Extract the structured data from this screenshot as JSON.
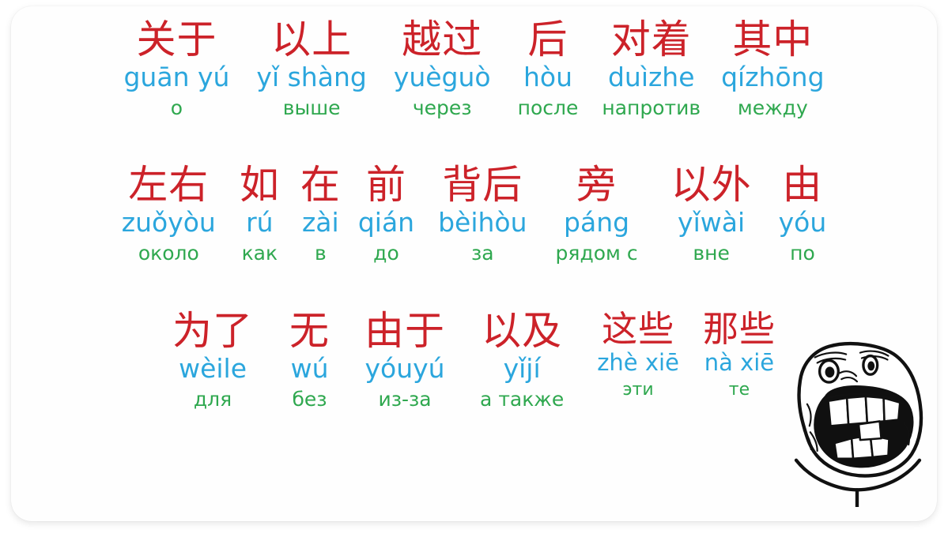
{
  "card": {
    "accent_red": "#cc2229",
    "accent_blue": "#2ba6dd",
    "accent_green": "#2fa84f",
    "background": "#fefefe"
  },
  "rows": [
    {
      "entries": [
        {
          "hanzi": "关于",
          "pinyin": "guān yú",
          "gloss": "о",
          "size": "",
          "gap": 0
        },
        {
          "hanzi": "以上",
          "pinyin": "yǐ shàng",
          "gloss": "выше",
          "size": "",
          "gap": 34
        },
        {
          "hanzi": "越过",
          "pinyin": "yuèguò",
          "gloss": "через",
          "size": "",
          "gap": 34
        },
        {
          "hanzi": "后",
          "pinyin": "hòu",
          "gloss": "после",
          "size": "",
          "gap": 34
        },
        {
          "hanzi": "对着",
          "pinyin": "duìzhe",
          "gloss": "напротив",
          "size": "",
          "gap": 30
        },
        {
          "hanzi": "其中",
          "pinyin": "qízhōng",
          "gloss": "между",
          "size": "",
          "gap": 26
        }
      ]
    },
    {
      "entries": [
        {
          "hanzi": "左右",
          "pinyin": "zuǒyòu",
          "gloss": "около",
          "size": "",
          "gap": 0
        },
        {
          "hanzi": "如",
          "pinyin": "rú",
          "gloss": "как",
          "size": "",
          "gap": 30
        },
        {
          "hanzi": "在",
          "pinyin": "zài",
          "gloss": "в",
          "size": "",
          "gap": 26
        },
        {
          "hanzi": "前",
          "pinyin": "qián",
          "gloss": "до",
          "size": "",
          "gap": 22
        },
        {
          "hanzi": "背后",
          "pinyin": "bèihòu",
          "gloss": "за",
          "size": "",
          "gap": 30
        },
        {
          "hanzi": "旁",
          "pinyin": "páng",
          "gloss": "рядом с",
          "size": "",
          "gap": 36
        },
        {
          "hanzi": "以外",
          "pinyin": "yǐwài",
          "gloss": "вне",
          "size": "",
          "gap": 42
        },
        {
          "hanzi": "由",
          "pinyin": "yóu",
          "gloss": "по",
          "size": "",
          "gap": 34
        }
      ]
    },
    {
      "entries": [
        {
          "hanzi": "为了",
          "pinyin": "wèile",
          "gloss": "для",
          "size": "",
          "gap": 0
        },
        {
          "hanzi": "无",
          "pinyin": "wú",
          "gloss": "без",
          "size": "",
          "gap": 46
        },
        {
          "hanzi": "由于",
          "pinyin": "yóuyú",
          "gloss": "из-за",
          "size": "",
          "gap": 44
        },
        {
          "hanzi": "以及",
          "pinyin": "yǐjí",
          "gloss": "а также",
          "size": "",
          "gap": 44
        },
        {
          "hanzi": "这些",
          "pinyin": "zhè xiē",
          "gloss": "эти",
          "size": "sm",
          "gap": 42
        },
        {
          "hanzi": "那些",
          "pinyin": "nà xiē",
          "gloss": "те",
          "size": "sm",
          "gap": 30
        }
      ]
    }
  ],
  "meme": {
    "name": "forever-alone-face",
    "alt": "Forever Alone rage comic face"
  }
}
